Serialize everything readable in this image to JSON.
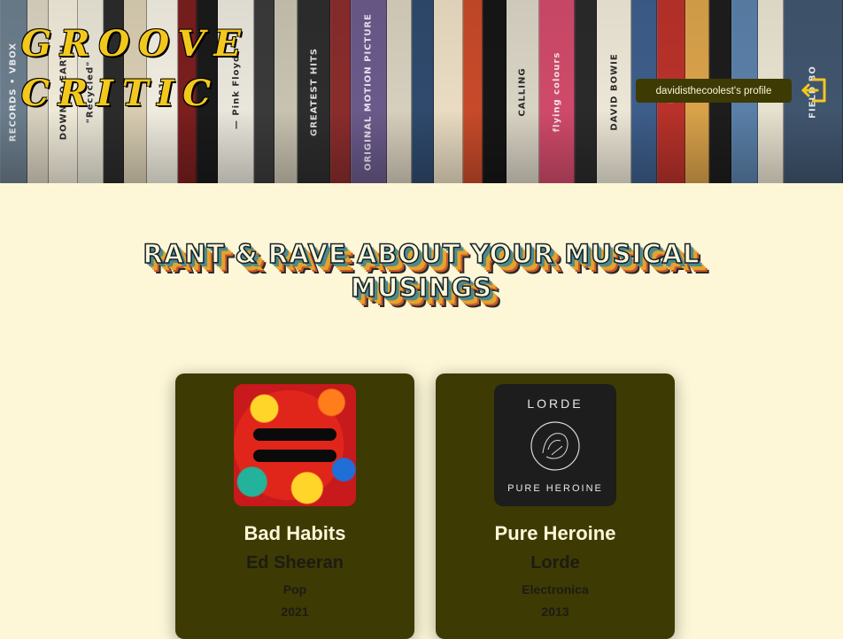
{
  "header": {
    "logo_line1": "GROOVE",
    "logo_line2": "CRITIC",
    "profile_button": "davidisthecoolest's profile",
    "logout_icon": "logout-icon",
    "shelf_spines": [
      {
        "text": "RECORDS • VBOX",
        "color": "#6b7d8c"
      },
      {
        "text": "",
        "color": "#d9d2c0"
      },
      {
        "text": "DOWN TO EARTH",
        "color": "#efe9d8"
      },
      {
        "text": "\"Recycled\"",
        "color": "#e8e4d5"
      },
      {
        "text": "",
        "color": "#2b2b2b"
      },
      {
        "text": "",
        "color": "#d8cdb2"
      },
      {
        "text": "781",
        "color": "#f0ece0"
      },
      {
        "text": "",
        "color": "#7a1e1e"
      },
      {
        "text": "",
        "color": "#1a1a1a"
      },
      {
        "text": "— Pink Floyd",
        "color": "#e9e6dc"
      },
      {
        "text": "",
        "color": "#3a3a3a"
      },
      {
        "text": "",
        "color": "#c8c2b0"
      },
      {
        "text": "GREATEST HITS",
        "color": "#2d2d2d"
      },
      {
        "text": "",
        "color": "#8a2c2c"
      },
      {
        "text": "ORIGINAL MOTION PICTURE",
        "color": "#6a5a8a"
      },
      {
        "text": "",
        "color": "#d7cfbd"
      },
      {
        "text": "",
        "color": "#2f4a6d"
      },
      {
        "text": "",
        "color": "#e9dcc2"
      },
      {
        "text": "",
        "color": "#c74a2a"
      },
      {
        "text": "",
        "color": "#161616"
      },
      {
        "text": "CALLING",
        "color": "#d9d3c4"
      },
      {
        "text": "flying colours",
        "color": "#cf4a6a"
      },
      {
        "text": "",
        "color": "#2a2a2a"
      },
      {
        "text": "DAVID BOWIE",
        "color": "#ece6d6"
      },
      {
        "text": "",
        "color": "#3d5d8a"
      },
      {
        "text": "Hell",
        "color": "#b8322a"
      },
      {
        "text": "",
        "color": "#d9a24a"
      },
      {
        "text": "",
        "color": "#1d1d1d"
      },
      {
        "text": "",
        "color": "#5a7fa8"
      },
      {
        "text": "",
        "color": "#e7e1cf"
      },
      {
        "text": "FIELD BO",
        "color": "#40556e"
      }
    ]
  },
  "main": {
    "heading": "RANT & RAVE ABOUT YOUR MUSICAL MUSINGS"
  },
  "albums": [
    {
      "title": "Bad Habits",
      "artist": "Ed Sheeran",
      "genre": "Pop",
      "year": "2021",
      "cover_text_top": "",
      "cover_text_bottom": ""
    },
    {
      "title": "Pure Heroine",
      "artist": "Lorde",
      "genre": "Electronica",
      "year": "2013",
      "cover_text_top": "LORDE",
      "cover_text_bottom": "PURE HEROINE"
    }
  ],
  "colors": {
    "background": "#fdf7d7",
    "card": "#3d3a04",
    "logo": "#f3c81c"
  }
}
